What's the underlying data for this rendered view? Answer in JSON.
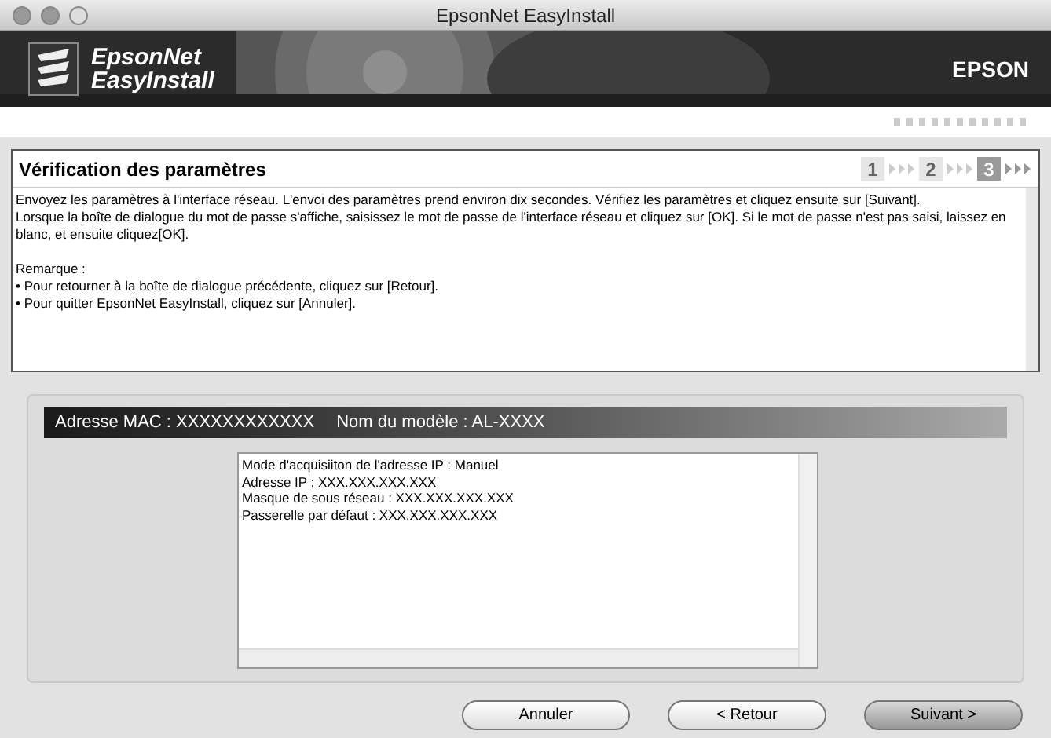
{
  "window": {
    "title": "EpsonNet EasyInstall"
  },
  "banner": {
    "product_line1": "EpsonNet",
    "product_line2": "EasyInstall",
    "brand": "EPSON"
  },
  "panel": {
    "title": "Vérification des paramètres",
    "steps": [
      {
        "label": "1",
        "selected": false
      },
      {
        "label": "2",
        "selected": false
      },
      {
        "label": "3",
        "selected": true
      }
    ],
    "paragraphs": [
      "Envoyez les paramètres à l'interface réseau. L'envoi des paramètres prend environ dix secondes. Vérifiez les paramètres et cliquez ensuite sur [Suivant].",
      "Lorsque la boîte de dialogue du mot de passe s'affiche, saisissez le mot de passe de l'interface réseau et cliquez sur [OK]. Si le mot de passe n'est pas saisi, laissez en blanc, et ensuite cliquez[OK]."
    ],
    "notes": [
      "Remarque :",
      "• Pour retourner à la boîte de dialogue précédente, cliquez sur [Retour].",
      "• Pour quitter EpsonNet EasyInstall, cliquez sur [Annuler]."
    ]
  },
  "device": {
    "mac": "Adresse MAC : XXXXXXXXXXXX",
    "model": "Nom du modèle : AL-XXXX",
    "settings": [
      "Mode d'acquisiiton de l'adresse IP : Manuel",
      "Adresse IP : XXX.XXX.XXX.XXX",
      "Masque de sous réseau : XXX.XXX.XXX.XXX",
      "Passerelle par défaut : XXX.XXX.XXX.XXX"
    ]
  },
  "buttons": [
    {
      "label": "Annuler",
      "default": false
    },
    {
      "label": "< Retour",
      "default": false
    },
    {
      "label": "Suivant >",
      "default": true
    }
  ]
}
